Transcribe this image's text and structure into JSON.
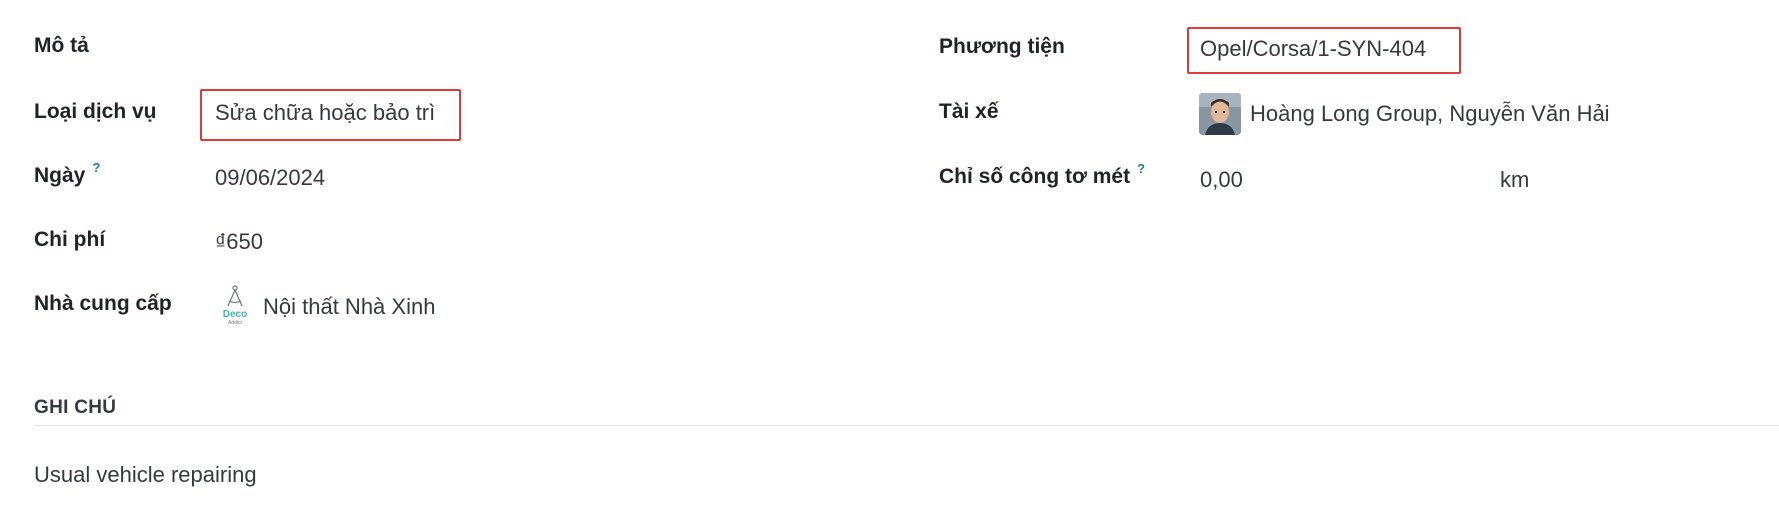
{
  "form": {
    "description_label": "Mô tả",
    "service_type_label": "Loại dịch vụ",
    "service_type_value": "Sửa chữa hoặc bảo trì",
    "date_label": "Ngày",
    "date_help": "?",
    "date_value": "09/06/2024",
    "cost_label": "Chi phí",
    "cost_value": "₫650",
    "vendor_label": "Nhà cung cấp",
    "vendor_value": "Nội thất Nhà Xinh",
    "vendor_logo_text": "Deco",
    "vendor_logo_subtext": "Addict",
    "vehicle_label": "Phương tiện",
    "vehicle_value": "Opel/Corsa/1-SYN-404",
    "driver_label": "Tài xế",
    "driver_value": "Hoàng Long Group, Nguyễn Văn Hải",
    "odometer_label": "Chỉ số công tơ mét",
    "odometer_help": "?",
    "odometer_value": "0,00",
    "odometer_unit": "km"
  },
  "notes": {
    "title": "GHI CHÚ",
    "text": "Usual vehicle repairing"
  },
  "colors": {
    "highlight": "#e03a3a",
    "help": "#1e7aa6",
    "logo_teal": "#3fb7a8"
  }
}
